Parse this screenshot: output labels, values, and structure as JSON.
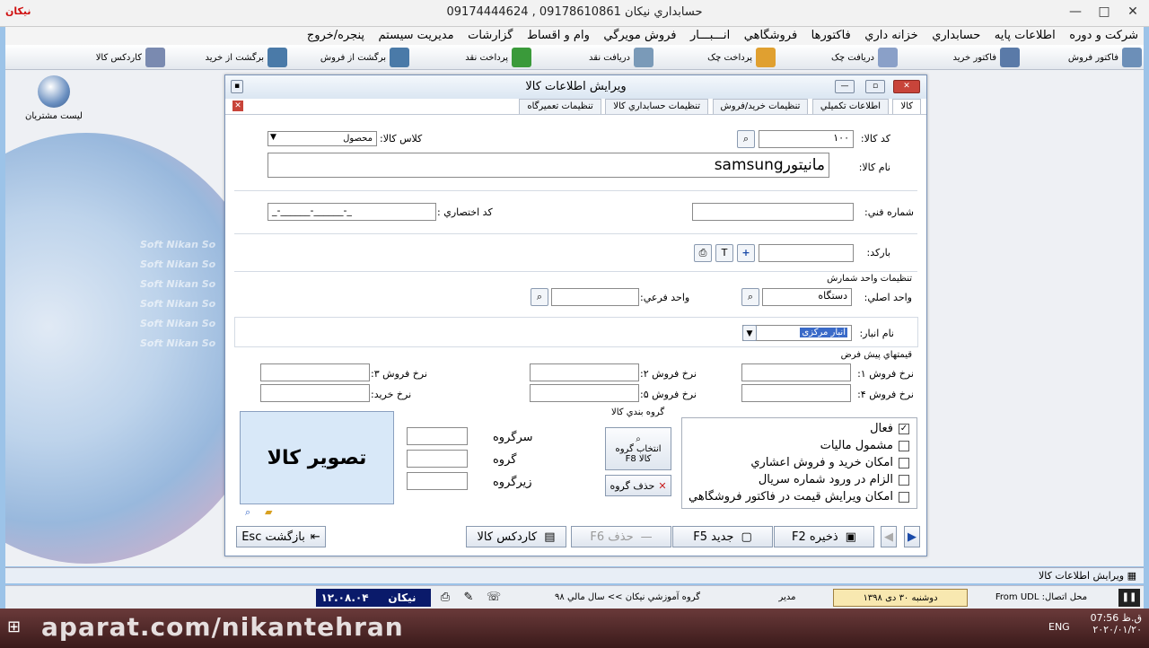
{
  "window": {
    "title": "حسابداري نيكان 09178610861 , 09174444624",
    "minimize": "—",
    "maximize": "□",
    "close": "✕"
  },
  "menu": [
    "شرکت و دوره",
    "اطلاعات پايه",
    "حسابداري",
    "خزانه داري",
    "فاکتورها",
    "فروشگاهي",
    "انـــبـــار",
    "فروش مويرگي",
    "وام و اقساط",
    "گزارشات",
    "مديريت سيستم",
    "پنجره/خروج"
  ],
  "toolbar": [
    {
      "label": "فاکتور فروش",
      "color": "#6c8fb8"
    },
    {
      "label": "فاکتور خريد",
      "color": "#5a7aa8"
    },
    {
      "label": "دريافت چک",
      "color": "#8aa0c8"
    },
    {
      "label": "پرداخت چک",
      "color": "#e0a030"
    },
    {
      "label": "دريافت نقد",
      "color": "#7a9ab8"
    },
    {
      "label": "پرداخت نقد",
      "color": "#3a9a3a"
    },
    {
      "label": "برگشت از فروش",
      "color": "#4a7aa8"
    },
    {
      "label": "برگشت از خريد",
      "color": "#4a7aa8"
    },
    {
      "label": "کاردکس کالا",
      "color": "#7a8ab0"
    }
  ],
  "desktop": {
    "icon_label": "ليست مشتريان",
    "watermark_line": "Soft Nikan So"
  },
  "dialog": {
    "title": "ويرايش اطلاعات کالا",
    "tabs": [
      "کالا",
      "اطلاعات تکميلي",
      "تنظيمات خريد/فروش",
      "تنظيمات حسابداري کالا",
      "تنظيمات تعميرگاه"
    ],
    "code_label": "کد کالا:",
    "code_value": "۱۰۰",
    "class_label": "کلاس کالا:",
    "class_value": "محصول",
    "name_label": "نام کالا:",
    "name_value": "مانيتورsamsung",
    "tech_label": "شماره فني:",
    "tech_value": "",
    "short_label": "کد اختصاري :",
    "short_value": "_-______-______-_",
    "barcode_label": "بارکد:",
    "barcode_value": "",
    "unit_section": "تنظيمات واحد شمارش",
    "main_unit_label": "واحد اصلي:",
    "main_unit_value": "دستگاه",
    "sub_unit_label": "واحد فرعي:",
    "sub_unit_value": "",
    "warehouse_label": "نام انبار:",
    "warehouse_value": "انبار مرکزی",
    "price_section": "قيمتهاي پيش فرض",
    "price_labels": {
      "r1": "نرخ فروش ۱:",
      "r2": "نرخ فروش ۲:",
      "r3": "نرخ فروش ۳:",
      "r4": "نرخ فروش ۴:",
      "r5": "نرخ فروش ۵:",
      "buy": "نرخ خريد:"
    },
    "checks": [
      {
        "label": "فعال",
        "checked": true
      },
      {
        "label": "مشمول ماليات",
        "checked": false
      },
      {
        "label": "امکان خريد و فروش اعشاري",
        "checked": false
      },
      {
        "label": "الزام در ورود شماره سريال",
        "checked": false
      },
      {
        "label": "امکان ويرايش قيمت در فاکتور فروشگاهي",
        "checked": false
      }
    ],
    "group_section": "گروه بندي کالا",
    "group_select_btn": "انتخاب گروه کالا F8",
    "group_delete_btn": "حذف گروه",
    "group_labels": [
      "سرگروه",
      "گروه",
      "زيرگروه"
    ],
    "image_label": "تصوير کالا",
    "buttons": {
      "save": "ذخيره F2",
      "new": "جديد F5",
      "delete": "حذف F6",
      "cardex": "کاردکس کالا",
      "back": "بازگشت Esc"
    }
  },
  "status": {
    "window_name": "ويرايش اطلاعات کالا",
    "connection": "محل اتصال: From UDL",
    "date": "دوشنبه ۳۰ دی ۱۳۹۸",
    "user": "مدير",
    "group": "گروه آموزشي نيکان >> سال مالي ۹۸",
    "brand": "نيکان",
    "version": "۱۲.۰۸.۰۴"
  },
  "taskbar": {
    "watermark": "aparat.com/nikantehran",
    "lang": "ENG",
    "time": "07:56 ق.ظ",
    "date": "۲۰۲۰/۰۱/۲۰"
  }
}
